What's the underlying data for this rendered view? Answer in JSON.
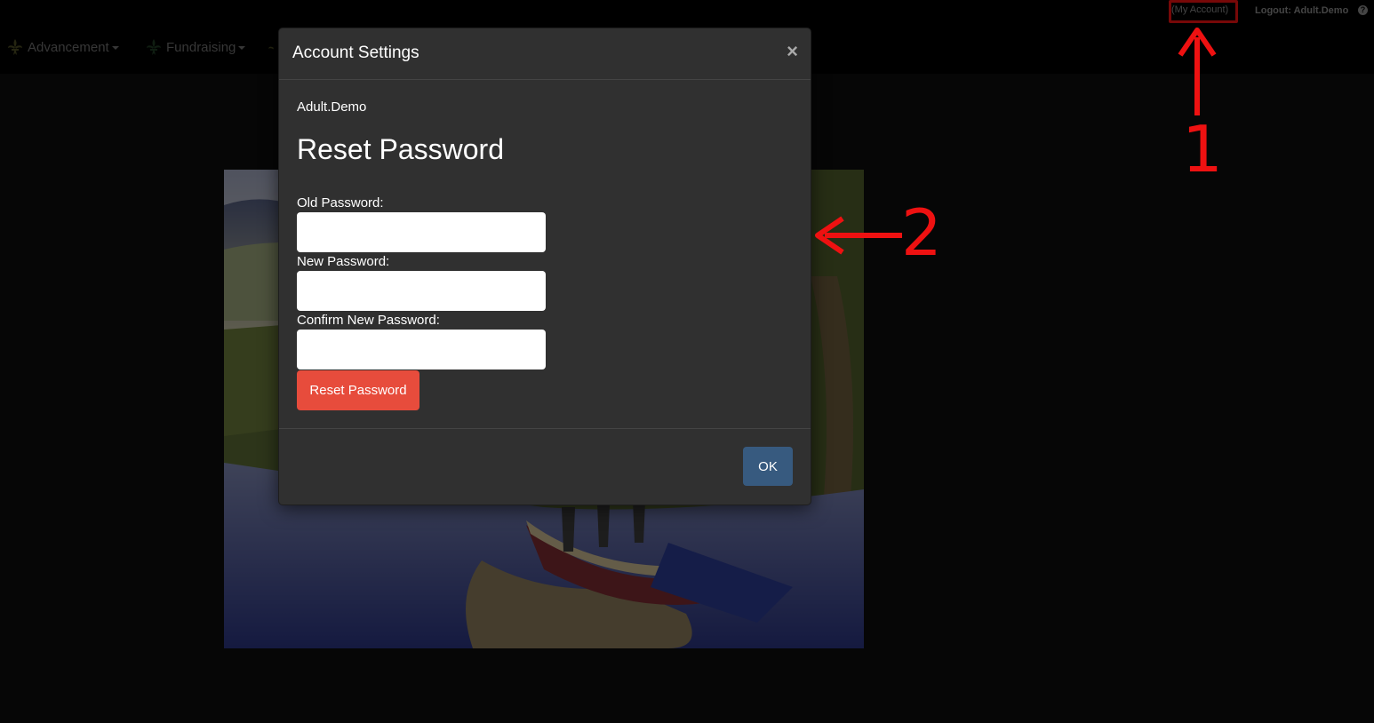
{
  "topbar": {
    "my_account_label": "(My Account)",
    "logout_label": "Logout: Adult.Demo",
    "help_icon": "question-circle-icon"
  },
  "nav": {
    "items": [
      {
        "label": "Advancement",
        "icon": "fleur-de-lis-icon"
      },
      {
        "label": "Fundraising",
        "icon": "fleur-de-lis-icon"
      }
    ]
  },
  "modal": {
    "title": "Account Settings",
    "close_label": "×",
    "username": "Adult.Demo",
    "section_title": "Reset Password",
    "fields": [
      {
        "label": "Old Password:",
        "value": ""
      },
      {
        "label": "New Password:",
        "value": ""
      },
      {
        "label": "Confirm New Password:",
        "value": ""
      }
    ],
    "reset_button_label": "Reset Password",
    "ok_button_label": "OK"
  },
  "annotations": {
    "marker_1": "1",
    "marker_2": "2",
    "color": "#ee1111"
  },
  "colors": {
    "reset_button": "#e74c3c",
    "ok_button": "#375a7f",
    "modal_bg": "#303030"
  }
}
